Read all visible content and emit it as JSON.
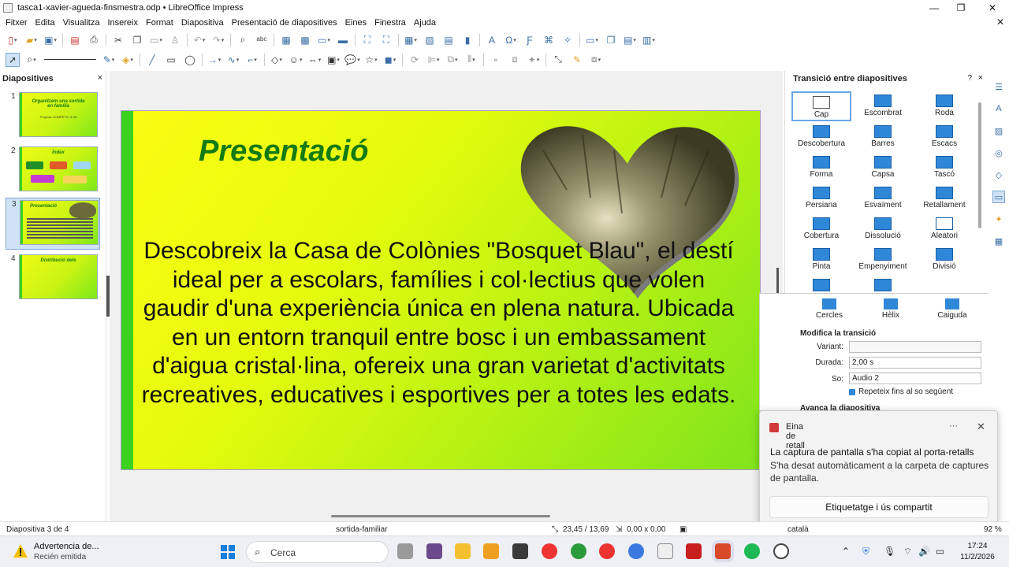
{
  "window": {
    "title": "tasca1-xavier-agueda-finsmestra.odp • LibreOffice Impress",
    "controls": {
      "minimize": "—",
      "maximize": "❐",
      "close": "✕"
    }
  },
  "menubar": [
    "Fitxer",
    "Edita",
    "Visualitza",
    "Insereix",
    "Format",
    "Diapositiva",
    "Presentació de diapositives",
    "Eines",
    "Finestra",
    "Ajuda"
  ],
  "slides_pane": {
    "title": "Diapositives",
    "close": "×",
    "thumbs": [
      {
        "num": "1",
        "title": "Organitzem una sortida en família",
        "sub": "Projecte COMPETIC 3 CE"
      },
      {
        "num": "2",
        "title": "Índex"
      },
      {
        "num": "3",
        "title": "Presentació"
      },
      {
        "num": "4",
        "title": "Distribució dels"
      }
    ]
  },
  "slide": {
    "title": "Presentació",
    "body": "Descobreix la Casa de Colònies \"Bosquet Blau\", el destí ideal per a escolars, famílies i col·lectius que volen gaudir d'una experiència única en plena natura. Ubicada en un entorn tranquil entre bosc i un embassament d'aigua cristal·lina, ofereix una gran varietat d'activitats recreatives, educatives i esportives per a totes les edats."
  },
  "sidebar": {
    "title": "Transició entre diapositives",
    "help": "?",
    "close": "×",
    "transitions": [
      "Cap",
      "Escombrat",
      "Roda",
      "Descobertura",
      "Barres",
      "Escacs",
      "Forma",
      "Capsa",
      "Tascó",
      "Persiana",
      "Esvaïment",
      "Retallament",
      "Cobertura",
      "Dissolució",
      "Aleatori",
      "Pinta",
      "Empenyiment",
      "Divisió"
    ],
    "transitions_row7": [
      "Cercles",
      "Hèlix",
      "Caiguda"
    ],
    "modify_title": "Modifica la transició",
    "variant_label": "Variant:",
    "variant_value": "",
    "duration_label": "Durada:",
    "duration_value": "2,00 s",
    "sound_label": "So:",
    "sound_value": "Audio 2",
    "repeat_label": "Repeteix fins al so següent",
    "advance_title": "Avança la diapositiva"
  },
  "toast": {
    "app": "Eina de retall",
    "more": "···",
    "close": "✕",
    "main": "La captura de pantalla s'ha copiat al porta-retalls",
    "sub": "S'ha desat automàticament a la carpeta de captures de pantalla.",
    "button": "Etiquetatge i ús compartit"
  },
  "statusbar": {
    "slide": "Diapositiva 3 de 4",
    "master": "sortida-familiar",
    "pos": "23,45 / 13,69",
    "size": "0,00 x 0,00",
    "lang": "català",
    "zoom": "92 %"
  },
  "taskbar": {
    "warn1": "Advertencia de...",
    "warn2": "Recién emitida",
    "search": "Cerca",
    "time": "17:24",
    "date": "11/2/2026"
  },
  "colors": {
    "slide_title": "#137a14",
    "slide_bar": "#3ad21e",
    "accent": "#2f87d8"
  }
}
